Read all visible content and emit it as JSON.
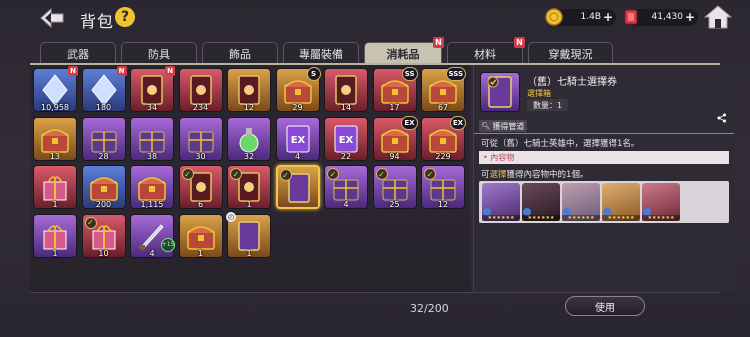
{
  "header": {
    "title": "背包",
    "help_label": "?",
    "currency_gold": "1.4B",
    "currency_gem": "41,430",
    "plus": "+"
  },
  "tabs": [
    {
      "label": "武器",
      "active": false,
      "badge": ""
    },
    {
      "label": "防具",
      "active": false,
      "badge": ""
    },
    {
      "label": "飾品",
      "active": false,
      "badge": ""
    },
    {
      "label": "專屬裝備",
      "active": false,
      "badge": ""
    },
    {
      "label": "消耗品",
      "active": true,
      "badge": "N"
    },
    {
      "label": "材料",
      "active": false,
      "badge": "N"
    },
    {
      "label": "穿戴現況",
      "active": false,
      "badge": ""
    }
  ],
  "items": [
    {
      "count": "10,958",
      "rarity": "blue",
      "badge": "N",
      "icon": "crystal-icon"
    },
    {
      "count": "180",
      "rarity": "blue",
      "badge": "N",
      "icon": "crystal-icon"
    },
    {
      "count": "34",
      "rarity": "red",
      "badge": "N",
      "icon": "card-icon"
    },
    {
      "count": "234",
      "rarity": "red",
      "badge": "",
      "icon": "card-icon"
    },
    {
      "count": "12",
      "rarity": "gold",
      "badge": "",
      "icon": "card-icon"
    },
    {
      "count": "29",
      "rarity": "gold",
      "tag": "S",
      "icon": "chest-icon"
    },
    {
      "count": "14",
      "rarity": "red",
      "badge": "",
      "icon": "card-icon"
    },
    {
      "count": "17",
      "rarity": "red",
      "tag": "SS",
      "icon": "chest-icon"
    },
    {
      "count": "67",
      "rarity": "gold",
      "tag": "SSS",
      "icon": "chest-icon"
    },
    {
      "count": "13",
      "rarity": "gold",
      "badge": "",
      "icon": "chest-icon"
    },
    {
      "count": "28",
      "rarity": "purple",
      "badge": "",
      "icon": "box-icon"
    },
    {
      "count": "38",
      "rarity": "purple",
      "badge": "",
      "icon": "box-icon"
    },
    {
      "count": "30",
      "rarity": "purple",
      "badge": "",
      "icon": "box-icon"
    },
    {
      "count": "32",
      "rarity": "purple",
      "badge": "",
      "icon": "potion-icon"
    },
    {
      "count": "4",
      "rarity": "purple",
      "tag": "",
      "icon": "ex-ticket-icon"
    },
    {
      "count": "22",
      "rarity": "red",
      "badge": "",
      "icon": "ex-ticket-icon"
    },
    {
      "count": "94",
      "rarity": "red",
      "tag": "EX",
      "icon": "chest-icon"
    },
    {
      "count": "229",
      "rarity": "red",
      "tag": "EX",
      "icon": "chest-icon"
    },
    {
      "count": "1",
      "rarity": "red",
      "badge": "",
      "icon": "gift-icon"
    },
    {
      "count": "200",
      "rarity": "blue",
      "badge": "",
      "icon": "chest-icon"
    },
    {
      "count": "1,115",
      "rarity": "purple",
      "badge": "",
      "icon": "chest-icon"
    },
    {
      "count": "6",
      "rarity": "red",
      "check": true,
      "icon": "card-icon"
    },
    {
      "count": "1",
      "rarity": "red",
      "check": true,
      "icon": "card-icon"
    },
    {
      "count": "",
      "rarity": "gold",
      "check": true,
      "selected": true,
      "icon": "ticket-icon"
    },
    {
      "count": "4",
      "rarity": "purple",
      "check": true,
      "icon": "box-icon"
    },
    {
      "count": "25",
      "rarity": "purple",
      "check": true,
      "icon": "box-icon"
    },
    {
      "count": "12",
      "rarity": "purple",
      "check": true,
      "icon": "box-icon"
    },
    {
      "count": "1",
      "rarity": "purple",
      "badge": "",
      "icon": "gift-icon"
    },
    {
      "count": "10",
      "rarity": "red",
      "check": true,
      "icon": "gift-icon"
    },
    {
      "count": "4",
      "rarity": "purple",
      "plus": "+15",
      "icon": "weapon-icon"
    },
    {
      "count": "1",
      "rarity": "gold",
      "badge": "",
      "icon": "chest-icon"
    },
    {
      "count": "1",
      "rarity": "gold",
      "timer": true,
      "icon": "ticket-icon"
    }
  ],
  "inventory_count": "32/200",
  "detail": {
    "name": "（舊）七騎士選擇券",
    "type": "選擇箱",
    "quantity": "數量：1",
    "acquire_label": "獲得管道",
    "description": "可從（舊）七騎士英雄中，選擇獲得1名。",
    "contents_header": "• 內容物",
    "choose_prefix": "可",
    "choose_highlight": "選擇",
    "choose_suffix": "獲得內容物中的1個。",
    "stars": "★★★★★★",
    "characters": [
      "hero-1",
      "hero-2",
      "hero-3",
      "hero-4",
      "hero-5"
    ]
  },
  "use_button": "使用"
}
